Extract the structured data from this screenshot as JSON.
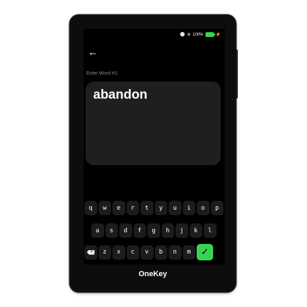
{
  "status_bar": {
    "battery_text": "100%",
    "battery_level": 1.0,
    "icons": [
      "usb-icon",
      "bluetooth-icon",
      "battery-icon",
      "charging-icon"
    ]
  },
  "header": {
    "back_icon": "arrow-left-icon"
  },
  "prompt": "Enter Word #1:",
  "input_word": "abandon",
  "keyboard": {
    "row1": [
      "q",
      "w",
      "e",
      "r",
      "t",
      "y",
      "u",
      "i",
      "o",
      "p"
    ],
    "row2": [
      "a",
      "s",
      "d",
      "f",
      "g",
      "h",
      "j",
      "k",
      "l"
    ],
    "row3": [
      "z",
      "x",
      "c",
      "v",
      "b",
      "n",
      "m"
    ],
    "delete_icon": "backspace-icon",
    "confirm_icon": "checkmark-icon"
  },
  "brand": "OneKey",
  "colors": {
    "accent": "#39d353",
    "screen_bg": "#000000",
    "input_bg": "#1f1f1f",
    "key_bg": "#1c1c1c"
  }
}
